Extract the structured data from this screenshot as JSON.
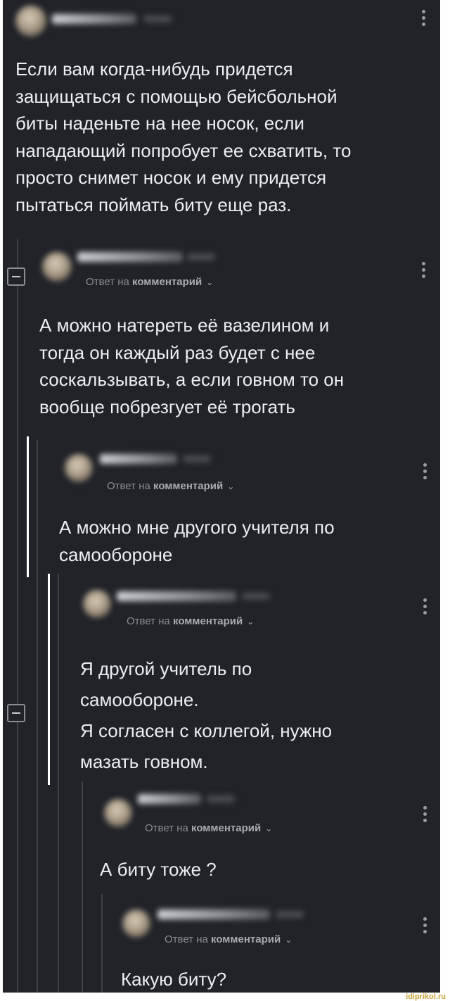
{
  "reply_prefix": "Ответ на",
  "reply_target": "комментарий",
  "chevron": "⌄",
  "more_icon": "kebab-vertical-icon",
  "collapse_icon": "minus-square-icon",
  "comments": [
    {
      "text": "Если вам когда-нибудь придется\nзащищаться с помощью бейсбольной\nбиты наденьте на нее носок, если\nнападающий попробует ее схватить, то\nпросто снимет носок и ему придется\nпытаться поймать биту еще раз."
    },
    {
      "text": "А можно натереть её вазелином и\nтогда он каждый раз будет с нее\nсоскальзывать, а если говном то он\nвообще побрезгует её трогать"
    },
    {
      "text": "А можно мне другого учителя по\nсамообороне"
    },
    {
      "text": "Я другой учитель по\nсамообороне.\nЯ согласен с коллегой, нужно\nмазать говном."
    },
    {
      "text": "А биту тоже ?"
    },
    {
      "text": "Какую биту?"
    }
  ],
  "watermark": "idiprikol.ru",
  "colors": {
    "background": "#212329",
    "text": "#eceef2",
    "muted": "#8b8d94",
    "thread_line": "#3f4148"
  }
}
